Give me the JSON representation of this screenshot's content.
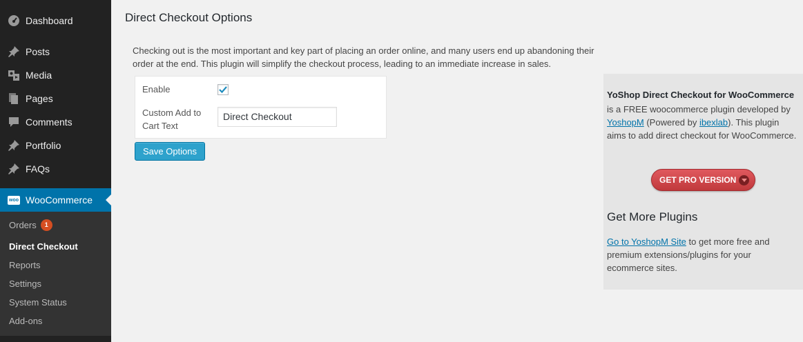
{
  "sidebar": {
    "items": [
      {
        "label": "Dashboard",
        "icon": "dashboard-icon"
      },
      {
        "label": "Posts",
        "icon": "pin-icon"
      },
      {
        "label": "Media",
        "icon": "media-icon"
      },
      {
        "label": "Pages",
        "icon": "pages-icon"
      },
      {
        "label": "Comments",
        "icon": "comment-icon"
      },
      {
        "label": "Portfolio",
        "icon": "pin-icon"
      },
      {
        "label": "FAQs",
        "icon": "pin-icon"
      },
      {
        "label": "WooCommerce",
        "icon": "woo-icon",
        "active": true
      }
    ],
    "woo_icon_text": "woo",
    "submenu": [
      {
        "label": "Orders",
        "badge": "1"
      },
      {
        "label": "Direct Checkout",
        "current": true
      },
      {
        "label": "Reports"
      },
      {
        "label": "Settings"
      },
      {
        "label": "System Status"
      },
      {
        "label": "Add-ons"
      }
    ]
  },
  "main": {
    "title": "Direct Checkout Options",
    "intro": "Checking out is the most important and key part of placing an order online, and many users end up abandoning their order at the end. This plugin will simplify the checkout process, leading to an immediate increase in sales.",
    "form": {
      "enable_label": "Enable",
      "enable_checked": true,
      "cart_text_label": "Custom Add to Cart Text",
      "cart_text_value": "Direct Checkout"
    },
    "save_label": "Save Options"
  },
  "promo": {
    "title": "YoShop Direct Checkout for WooCommerce",
    "desc_1": "is a FREE woocommerce plugin developed by ",
    "link_yoshopm": "YoshopM",
    "desc_2": " (Powered by ",
    "link_ibexlab": "ibexlab",
    "desc_3": "). This plugin aims to add direct checkout for WooCommerce.",
    "pro_button": "GET PRO VERSION",
    "more_title": "Get More Plugins",
    "more_link": "Go to YoshopM Site",
    "more_desc": " to get more free and premium extensions/plugins for your ecommerce sites."
  },
  "colors": {
    "sidebar_bg": "#222222",
    "active_bg": "#0073aa",
    "button_blue": "#2ea2cc",
    "pro_red": "#d9474b",
    "badge": "#d54e21"
  }
}
